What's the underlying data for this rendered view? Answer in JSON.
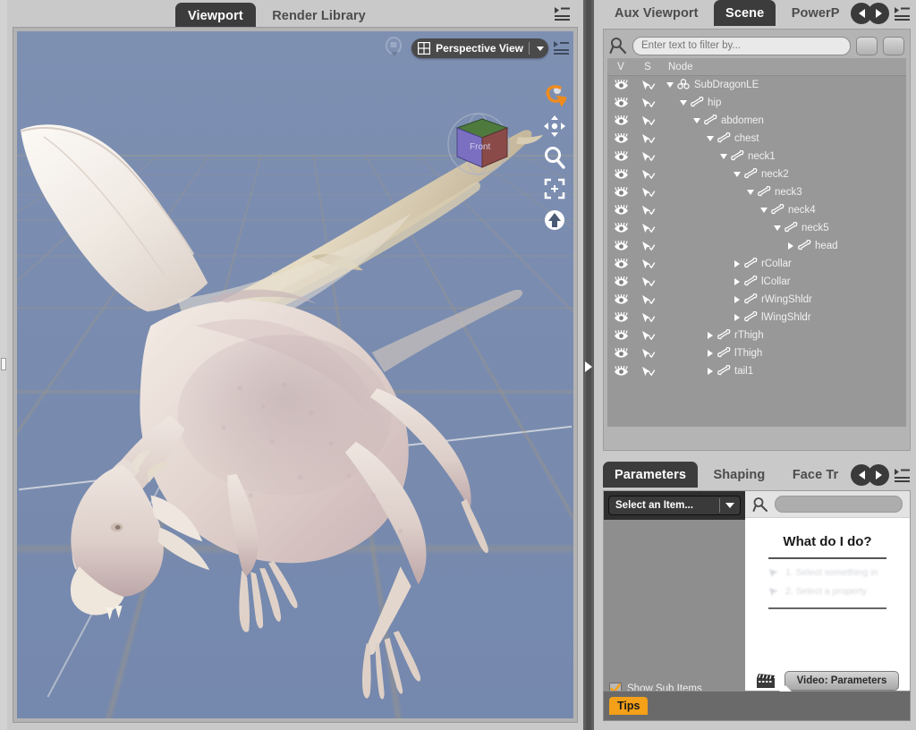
{
  "app": {
    "bg_color": "#c9c9c9",
    "accent_color": "#f4a018",
    "viewport_bg_color": "#7b8db0"
  },
  "left_panel": {
    "tabs": [
      {
        "label": "Viewport",
        "active": true
      },
      {
        "label": "Render Library",
        "active": false
      }
    ],
    "menu_icon": "pane-options-icon",
    "viewport": {
      "camera_icon": "camera-icon",
      "view_dropdown": {
        "grid_icon": "grid-icon",
        "label": "Perspective View",
        "chevron": "chevron-down-icon"
      },
      "pane_menu_icon": "pane-options-icon",
      "navcube": {
        "front_label": "Front",
        "front_color": "#7a6fc0",
        "top_color": "#4e7a3e",
        "side_color": "#8a4a48"
      },
      "tools": [
        {
          "name": "orbit-tool",
          "icon": "orbit-icon",
          "color": "#ef8b1d"
        },
        {
          "name": "pan-tool",
          "icon": "four-arrows-icon"
        },
        {
          "name": "zoom-tool",
          "icon": "magnifier-icon"
        },
        {
          "name": "frame-tool",
          "icon": "frame-selection-icon"
        },
        {
          "name": "reset-view-tool",
          "icon": "arrow-up-circle-icon"
        }
      ],
      "content_description": "3D rendered dragon figure on a perspective ground grid"
    }
  },
  "right_panel": {
    "scene_panel": {
      "tabs": [
        {
          "label": "Aux Viewport",
          "active": false
        },
        {
          "label": "Scene",
          "active": true
        },
        {
          "label": "PowerP",
          "active": false
        }
      ],
      "tab_prev_icon": "chevron-left-icon",
      "tab_next_icon": "chevron-right-icon",
      "menu_icon": "pane-options-icon",
      "filter": {
        "search_icon": "search-icon",
        "placeholder": "Enter text to filter by...",
        "value": "",
        "prev_icon": "triangle-left-icon",
        "next_icon": "triangle-right-icon"
      },
      "columns": {
        "visibility": "V",
        "selectable": "S",
        "node": "Node"
      },
      "nodes": [
        {
          "label": "SubDragonLE",
          "depth": 0,
          "twisty": "open",
          "icon": "figure-icon"
        },
        {
          "label": "hip",
          "depth": 1,
          "twisty": "open",
          "icon": "bone-icon"
        },
        {
          "label": "abdomen",
          "depth": 2,
          "twisty": "open",
          "icon": "bone-icon"
        },
        {
          "label": "chest",
          "depth": 3,
          "twisty": "open",
          "icon": "bone-icon"
        },
        {
          "label": "neck1",
          "depth": 4,
          "twisty": "open",
          "icon": "bone-icon"
        },
        {
          "label": "neck2",
          "depth": 5,
          "twisty": "open",
          "icon": "bone-icon"
        },
        {
          "label": "neck3",
          "depth": 6,
          "twisty": "open",
          "icon": "bone-icon"
        },
        {
          "label": "neck4",
          "depth": 7,
          "twisty": "open",
          "icon": "bone-icon"
        },
        {
          "label": "neck5",
          "depth": 8,
          "twisty": "open",
          "icon": "bone-icon"
        },
        {
          "label": "head",
          "depth": 9,
          "twisty": "closed",
          "icon": "bone-icon"
        },
        {
          "label": "rCollar",
          "depth": 5,
          "twisty": "closed",
          "icon": "bone-icon"
        },
        {
          "label": "lCollar",
          "depth": 5,
          "twisty": "closed",
          "icon": "bone-icon"
        },
        {
          "label": "rWingShldr",
          "depth": 5,
          "twisty": "closed",
          "icon": "bone-icon"
        },
        {
          "label": "lWingShldr",
          "depth": 5,
          "twisty": "closed",
          "icon": "bone-icon"
        },
        {
          "label": "rThigh",
          "depth": 3,
          "twisty": "closed",
          "icon": "bone-icon"
        },
        {
          "label": "lThigh",
          "depth": 3,
          "twisty": "closed",
          "icon": "bone-icon"
        },
        {
          "label": "tail1",
          "depth": 3,
          "twisty": "closed",
          "icon": "bone-icon"
        }
      ]
    },
    "parameters_panel": {
      "tabs": [
        {
          "label": "Parameters",
          "active": true
        },
        {
          "label": "Shaping",
          "active": false
        },
        {
          "label": "Face Tr",
          "active": false
        }
      ],
      "tab_prev_icon": "chevron-left-icon",
      "tab_next_icon": "chevron-right-icon",
      "menu_icon": "pane-options-icon",
      "item_select": {
        "label": "Select an Item...",
        "chevron": "chevron-down-icon"
      },
      "show_sub_items": {
        "label": "Show Sub Items",
        "checked": true,
        "check_color": "#f4a018"
      },
      "search": {
        "icon": "search-icon",
        "value": ""
      },
      "help": {
        "title": "What do I do?",
        "steps": [
          "1. Select something in",
          "2. Select a property"
        ],
        "video_icon": "film-clapper-icon",
        "video_button": "Video: Parameters"
      }
    },
    "tips_bar": {
      "label": "Tips"
    }
  }
}
